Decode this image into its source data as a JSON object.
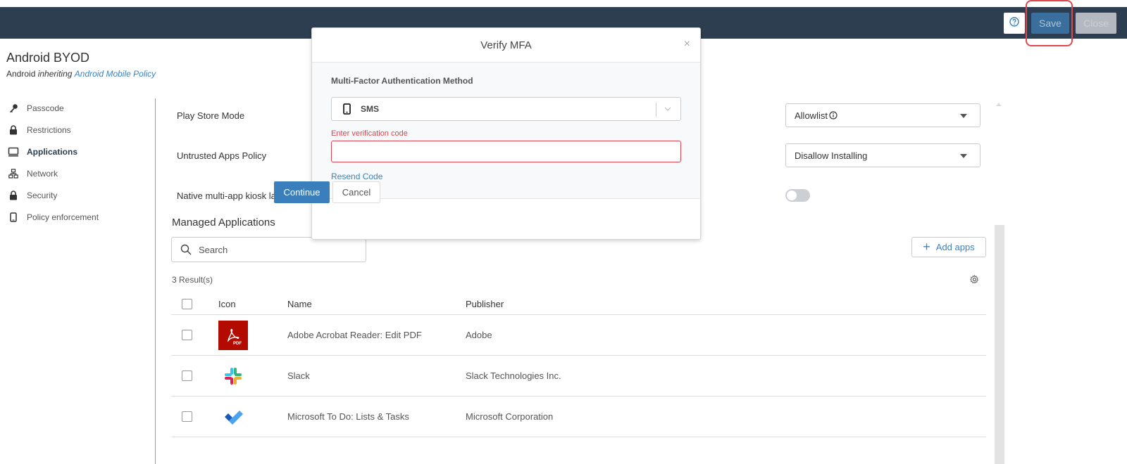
{
  "topbar": {
    "help_icon": "question-circle-icon",
    "save_label": "Save",
    "close_label": "Close"
  },
  "header": {
    "title": "Android BYOD",
    "platform": "Android",
    "inheriting_word": "inheriting",
    "parent_policy_link": "Android Mobile Policy"
  },
  "sidebar": {
    "items": [
      {
        "label": "Passcode",
        "icon": "key-icon",
        "active": false
      },
      {
        "label": "Restrictions",
        "icon": "lock-icon",
        "active": false
      },
      {
        "label": "Applications",
        "icon": "monitor-icon",
        "active": true
      },
      {
        "label": "Network",
        "icon": "network-icon",
        "active": false
      },
      {
        "label": "Security",
        "icon": "lock-icon",
        "active": false
      },
      {
        "label": "Policy enforcement",
        "icon": "phone-icon",
        "active": false
      }
    ]
  },
  "settings": {
    "play_store_mode": {
      "label": "Play Store Mode",
      "value": "Allowlist",
      "info_icon": "info-icon"
    },
    "untrusted_apps": {
      "label": "Untrusted Apps Policy",
      "value": "Disallow Installing"
    },
    "kiosk_launcher": {
      "label": "Native multi-app kiosk launcher",
      "enabled": false
    }
  },
  "managed_apps": {
    "title": "Managed Applications",
    "search_placeholder": "Search",
    "add_apps_label": "Add apps",
    "results_text": "3 Result(s)",
    "columns": [
      "Icon",
      "Name",
      "Publisher"
    ],
    "rows": [
      {
        "name": "Adobe Acrobat Reader: Edit PDF",
        "publisher": "Adobe",
        "icon": "adobe-acrobat-icon"
      },
      {
        "name": "Slack",
        "publisher": "Slack Technologies Inc.",
        "icon": "slack-icon"
      },
      {
        "name": "Microsoft To Do: Lists & Tasks",
        "publisher": "Microsoft Corporation",
        "icon": "microsoft-todo-icon"
      }
    ]
  },
  "modal": {
    "title": "Verify MFA",
    "method_label": "Multi-Factor Authentication Method",
    "method_value": "SMS",
    "code_label": "Enter verification code",
    "code_value": "",
    "resend_label": "Resend Code",
    "continue_label": "Continue",
    "cancel_label": "Cancel"
  },
  "colors": {
    "topbar": "#2c3e50",
    "primary": "#3a7fbb",
    "error": "#d94452",
    "link": "#3a83c2",
    "highlight": "#e0474c"
  }
}
